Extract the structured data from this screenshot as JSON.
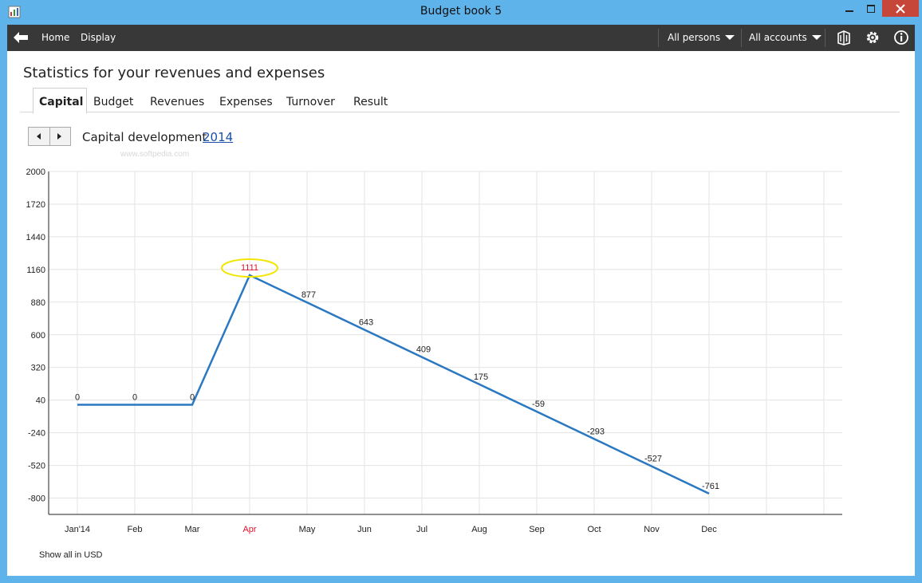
{
  "window": {
    "title": "Budget book 5"
  },
  "menu": {
    "home": "Home",
    "display": "Display",
    "persons": "All persons",
    "accounts": "All accounts"
  },
  "page": {
    "heading": "Statistics for your revenues and expenses",
    "tabs": [
      "Capital",
      "Budget",
      "Revenues",
      "Expenses",
      "Turnover",
      "Result"
    ],
    "active_tab": "Capital",
    "chart_label": "Capital development",
    "year": "2014",
    "watermark": "www.softpedia.com",
    "footer": "Show all in USD"
  },
  "colors": {
    "line": "#2a78c2",
    "highlight": "#e0102a",
    "circle": "#f2e600",
    "menubar": "#383838",
    "titlebar": "#5eb3ea"
  },
  "chart_data": {
    "type": "line",
    "x": [
      "Jan'14",
      "Feb",
      "Mar",
      "Apr",
      "May",
      "Jun",
      "Jul",
      "Aug",
      "Sep",
      "Oct",
      "Nov",
      "Dec"
    ],
    "series": [
      {
        "values": [
          0,
          0,
          0,
          1111,
          877,
          643,
          409,
          175,
          -59,
          -293,
          -527,
          -761
        ]
      }
    ],
    "yticks": [
      2000,
      1720,
      1440,
      1160,
      880,
      600,
      320,
      40,
      -240,
      -520,
      -800
    ],
    "ylim": [
      -940,
      2000
    ],
    "highlight_category": "Apr",
    "grid": true
  }
}
